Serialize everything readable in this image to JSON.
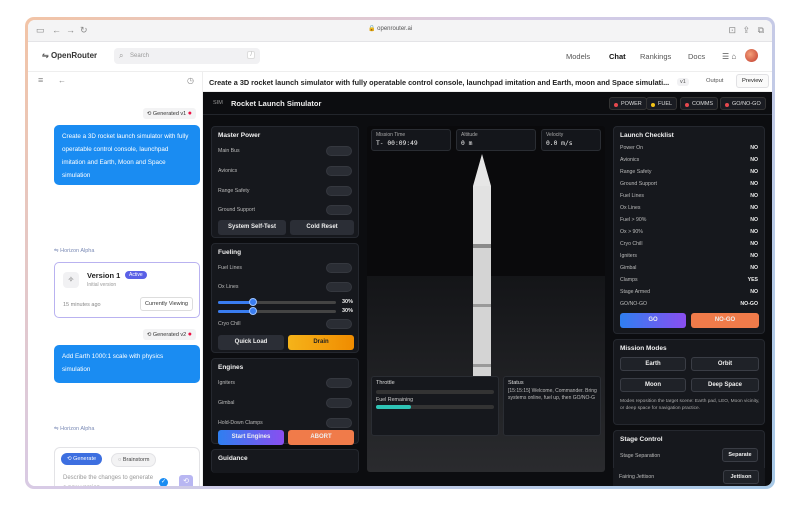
{
  "browser": {
    "url": "openrouter.ai"
  },
  "nav": {
    "logo": "OpenRouter",
    "search_placeholder": "Search",
    "search_kbd": "/",
    "models": "Models",
    "chat": "Chat",
    "rankings": "Rankings",
    "docs": "Docs"
  },
  "chat": {
    "msg1_tag": "Generated v1",
    "msg1": "Create a 3D rocket launch simulator with fully operatable control console, launchpad imitation and Earth, Moon and Space simulation",
    "model1": "Horizon Alpha",
    "version": {
      "title": "Version 1",
      "badge": "Active",
      "subtitle": "Initial version",
      "time": "15 minutes ago",
      "button": "Currently Viewing"
    },
    "msg2_tag": "Generated v2",
    "msg2": "Add Earth 1000:1 scale with physics simulation",
    "model2": "Horizon Alpha",
    "composer": {
      "generate": "Generate",
      "brainstorm": "Brainstorm",
      "placeholder": "Describe the changes to generate a new version..."
    }
  },
  "artifact": {
    "title": "Create a 3D rocket launch simulator with fully operatable control console, launchpad imitation and Earth, moon and Space simulati...",
    "version": "v1",
    "output": "Output",
    "preview": "Preview"
  },
  "sim": {
    "badge": "SIM",
    "title": "Rocket Launch Simulator",
    "status": [
      {
        "label": "POWER",
        "color": "#e5484d"
      },
      {
        "label": "FUEL",
        "color": "#f5c518"
      },
      {
        "label": "COMMS",
        "color": "#e5484d"
      },
      {
        "label": "GO/NO-GO",
        "color": "#e5484d"
      }
    ],
    "master_power": {
      "title": "Master Power",
      "rows": [
        "Main Bus",
        "Avionics",
        "Range Safety",
        "Ground Support"
      ],
      "self_test": "System Self-Test",
      "cold_reset": "Cold Reset"
    },
    "fueling": {
      "title": "Fueling",
      "rows": [
        "Fuel Lines",
        "Ox Lines"
      ],
      "fuel_pct": "30%",
      "ox_pct": "30%",
      "fuel_level": 0.3,
      "ox_level": 0.3,
      "cryo": "Cryo Chill",
      "quick_load": "Quick Load",
      "drain": "Drain"
    },
    "engines": {
      "title": "Engines",
      "rows": [
        "Igniters",
        "Gimbal",
        "Hold-Down Clamps"
      ],
      "start": "Start Engines",
      "abort": "ABORT"
    },
    "guidance": {
      "title": "Guidance"
    },
    "readouts": [
      {
        "label": "Mission Time",
        "value": "T- 00:09:49"
      },
      {
        "label": "Altitude",
        "value": "0 m"
      },
      {
        "label": "Velocity",
        "value": "0.0 m/s"
      }
    ],
    "throttle": {
      "label": "Throttle",
      "fuel_label": "Fuel Remaining",
      "fuel_level": 0.3
    },
    "status_box": {
      "label": "Status",
      "text": "[15:15:15] Welcome, Commander. Bring systems online, fuel up, then GO/NO-G"
    },
    "checklist": {
      "title": "Launch Checklist",
      "items": [
        {
          "label": "Power On",
          "state": "NO"
        },
        {
          "label": "Avionics",
          "state": "NO"
        },
        {
          "label": "Range Safety",
          "state": "NO"
        },
        {
          "label": "Ground Support",
          "state": "NO"
        },
        {
          "label": "Fuel Lines",
          "state": "NO"
        },
        {
          "label": "Ox Lines",
          "state": "NO"
        },
        {
          "label": "Fuel > 90%",
          "state": "NO"
        },
        {
          "label": "Ox > 90%",
          "state": "NO"
        },
        {
          "label": "Cryo Chill",
          "state": "NO"
        },
        {
          "label": "Igniters",
          "state": "NO"
        },
        {
          "label": "Gimbal",
          "state": "NO"
        },
        {
          "label": "Clamps",
          "state": "YES"
        },
        {
          "label": "Stage Armed",
          "state": "NO"
        },
        {
          "label": "GO/NO-GO",
          "state": "NO-GO"
        }
      ],
      "go": "GO",
      "nogo": "NO-GO"
    },
    "modes": {
      "title": "Mission Modes",
      "earth": "Earth",
      "orbit": "Orbit",
      "moon": "Moon",
      "deep": "Deep Space",
      "desc": "Modes reposition the target scene: Earth pad, LEO, Moon vicinity, or deep space for navigation practice."
    },
    "stage": {
      "title": "Stage Control",
      "sep_label": "Stage Separation",
      "sep_btn": "Separate",
      "fair_label": "Fairing Jettison",
      "fair_btn": "Jettison"
    }
  }
}
